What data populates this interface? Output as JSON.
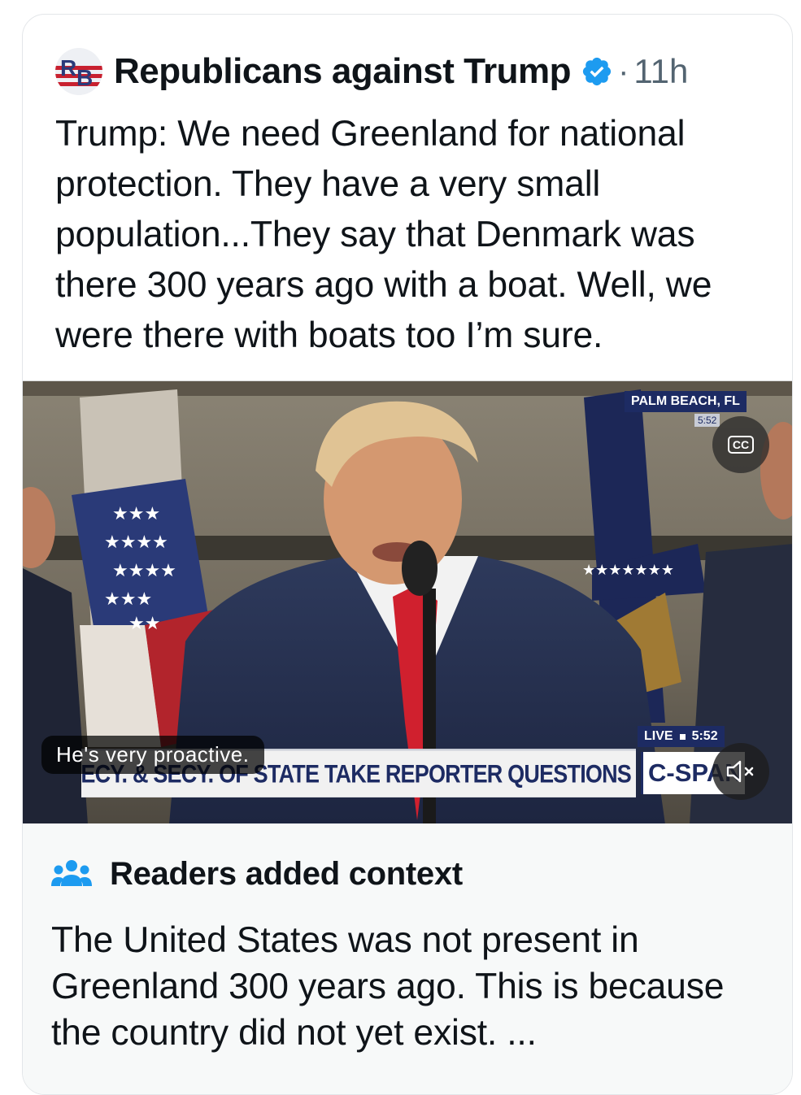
{
  "post": {
    "author": "Republicans against Trump",
    "avatar_initials": "RB",
    "verified": true,
    "separator": "·",
    "time": "11h",
    "text": "Trump: We need Greenland for national protection. They have a very small population...They say that Denmark was there 300 years ago with a boat. Well, we were there with boats too I’m sure."
  },
  "video": {
    "location": "PALM BEACH, FL",
    "location_time": "5:52",
    "cc_label": "CC",
    "caption": "He's very proactive.",
    "lower_third": "PRES. TRUMP, DEFENSE SECY. & SECY. OF STATE TAKE REPORTER QUESTIONS",
    "network": "C-SPAN",
    "live_label": "LIVE",
    "live_time": "5:52"
  },
  "community_note": {
    "title": "Readers added context",
    "text": "The United States was not present in Greenland 300 years ago. This is because the country did not yet exist. ..."
  },
  "colors": {
    "verified_blue": "#1d9bf0",
    "text_primary": "#0f1419",
    "text_secondary": "#536471",
    "note_background": "#f7f9f9",
    "cspan_navy": "#1d2b63"
  },
  "icons": {
    "verified": "verified-badge-icon",
    "people": "people-icon",
    "mute": "speaker-muted-icon",
    "cc": "closed-captions-icon"
  }
}
